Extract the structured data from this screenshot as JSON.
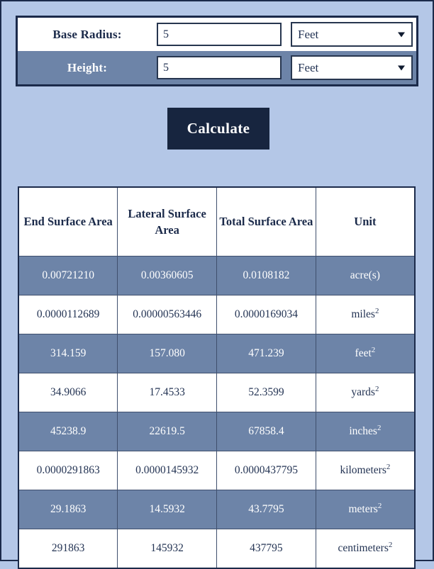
{
  "colors": {
    "page_background": "#b4c7e7",
    "panel_border": "#1b2a4a",
    "row_alt": "#6d84a8",
    "button_background": "#17253f",
    "text_dark": "#1b2a4a",
    "text_light": "#ffffff"
  },
  "form": {
    "rows": [
      {
        "label": "Base Radius:",
        "value": "5",
        "placeholder": "",
        "unit": "Feet",
        "caret_icon": "chevron-down-icon"
      },
      {
        "label": "Height:",
        "value": "5",
        "placeholder": "",
        "unit": "Feet",
        "caret_icon": "chevron-down-icon"
      }
    ]
  },
  "actions": {
    "calculate_label": "Calculate"
  },
  "results": {
    "headers": [
      "End Surface Area",
      "Lateral Surface Area",
      "Total Surface Area",
      "Unit"
    ],
    "rows": [
      {
        "end_surface_area": "0.00721210",
        "lateral_surface_area": "0.00360605",
        "total_surface_area": "0.0108182",
        "unit_base": "acre(s)",
        "unit_exponent": ""
      },
      {
        "end_surface_area": "0.0000112689",
        "lateral_surface_area": "0.00000563446",
        "total_surface_area": "0.0000169034",
        "unit_base": "miles",
        "unit_exponent": "2"
      },
      {
        "end_surface_area": "314.159",
        "lateral_surface_area": "157.080",
        "total_surface_area": "471.239",
        "unit_base": "feet",
        "unit_exponent": "2"
      },
      {
        "end_surface_area": "34.9066",
        "lateral_surface_area": "17.4533",
        "total_surface_area": "52.3599",
        "unit_base": "yards",
        "unit_exponent": "2"
      },
      {
        "end_surface_area": "45238.9",
        "lateral_surface_area": "22619.5",
        "total_surface_area": "67858.4",
        "unit_base": "inches",
        "unit_exponent": "2"
      },
      {
        "end_surface_area": "0.0000291863",
        "lateral_surface_area": "0.0000145932",
        "total_surface_area": "0.0000437795",
        "unit_base": "kilometers",
        "unit_exponent": "2"
      },
      {
        "end_surface_area": "29.1863",
        "lateral_surface_area": "14.5932",
        "total_surface_area": "43.7795",
        "unit_base": "meters",
        "unit_exponent": "2"
      },
      {
        "end_surface_area": "291863",
        "lateral_surface_area": "145932",
        "total_surface_area": "437795",
        "unit_base": "centimeters",
        "unit_exponent": "2"
      }
    ]
  }
}
